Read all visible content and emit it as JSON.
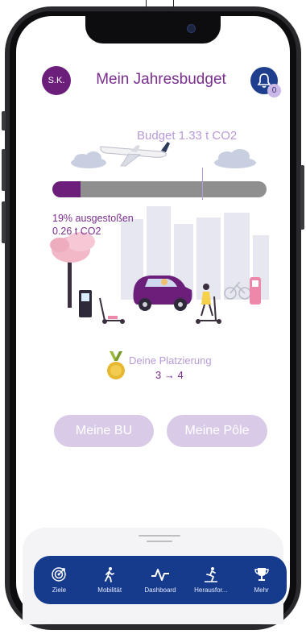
{
  "header": {
    "avatar_initials": "S.K.",
    "title": "Mein Jahresbudget",
    "notification_count": "0"
  },
  "budget": {
    "label": "Budget  1.33 t CO2",
    "emitted_percent_text": "19% ausgestoßen",
    "emitted_amount_text": "0.26 t CO2",
    "progress_fraction": 0.13,
    "marker_fraction": 0.7
  },
  "ranking": {
    "label": "Deine Platzierung",
    "value": "3 → 4"
  },
  "buttons": {
    "bu": "Meine BU",
    "pole": "Meine Pôle"
  },
  "nav": {
    "items": [
      {
        "label": "Ziele",
        "icon": "target-icon"
      },
      {
        "label": "Mobilität",
        "icon": "walking-icon"
      },
      {
        "label": "Dashboard",
        "icon": "activity-icon"
      },
      {
        "label": "Herausfor...",
        "icon": "climbing-icon"
      },
      {
        "label": "Mehr",
        "icon": "trophy-icon"
      }
    ]
  },
  "colors": {
    "primary_purple": "#6b1f7a",
    "light_purple": "#b79ad6",
    "nav_blue": "#163a8c",
    "button_lavender": "#d9cbe8"
  }
}
